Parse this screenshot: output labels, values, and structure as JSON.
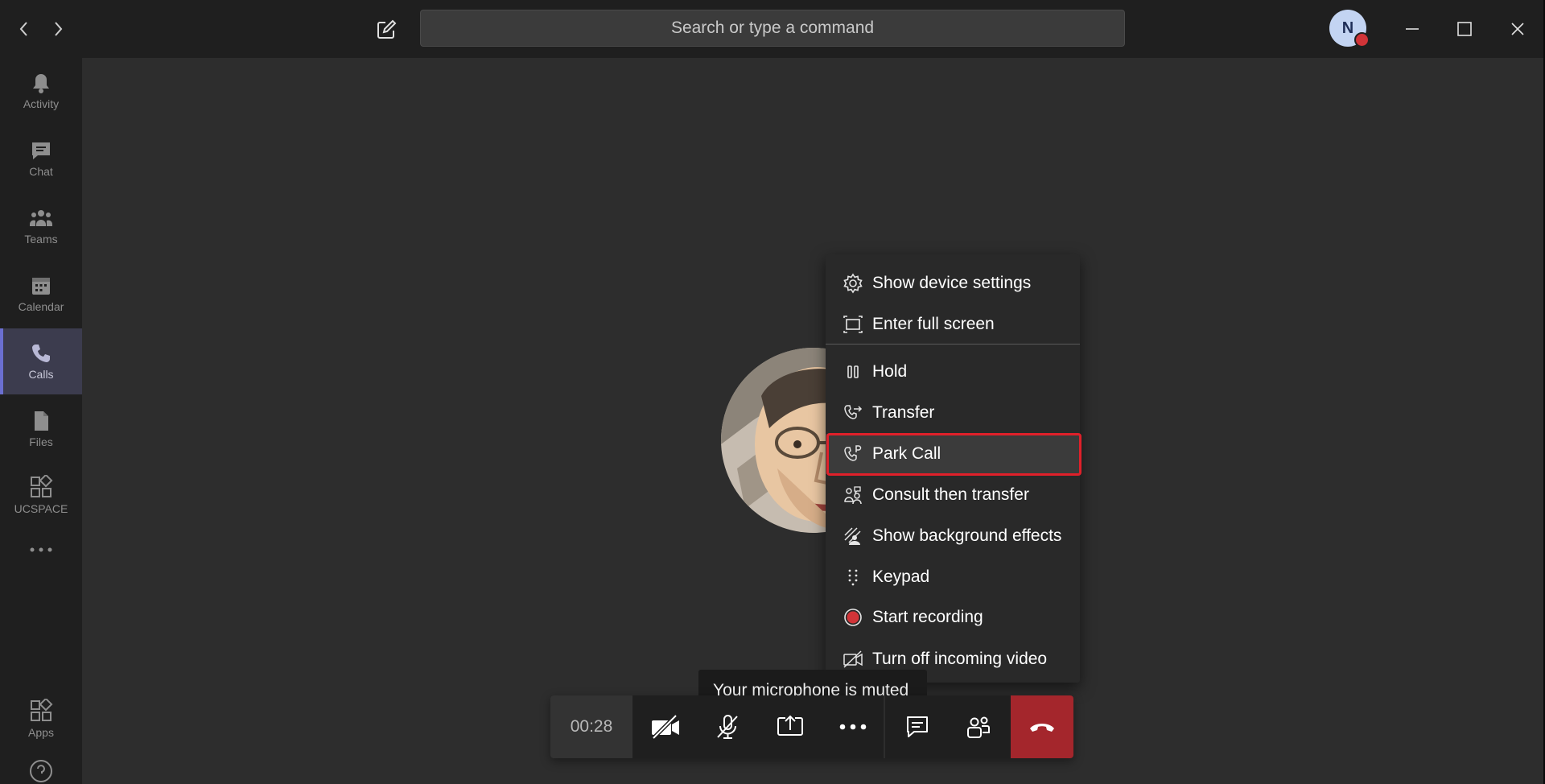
{
  "titlebar": {
    "back_icon": "chevron-left-icon",
    "forward_icon": "chevron-right-icon",
    "compose_icon": "compose-icon",
    "search_placeholder": "Search or type a command",
    "avatar_initial": "N",
    "presence_color": "#d13438"
  },
  "rail": {
    "items": [
      {
        "label": "Activity",
        "icon": "bell-icon"
      },
      {
        "label": "Chat",
        "icon": "chat-icon"
      },
      {
        "label": "Teams",
        "icon": "teams-icon"
      },
      {
        "label": "Calendar",
        "icon": "calendar-icon"
      },
      {
        "label": "Calls",
        "icon": "phone-icon",
        "active": true
      },
      {
        "label": "Files",
        "icon": "file-icon"
      },
      {
        "label": "UCSPACE",
        "icon": "app-grid-icon"
      },
      {
        "label": "",
        "icon": "more-icon"
      }
    ],
    "apps_label": "Apps",
    "help_icon": "help-icon"
  },
  "menu": {
    "items": [
      {
        "label": "Show device settings",
        "icon": "gear-icon"
      },
      {
        "label": "Enter full screen",
        "icon": "fullscreen-icon"
      },
      {
        "label": "Hold",
        "icon": "pause-icon"
      },
      {
        "label": "Transfer",
        "icon": "transfer-icon"
      },
      {
        "label": "Park Call",
        "icon": "park-call-icon",
        "highlighted": true
      },
      {
        "label": "Consult then transfer",
        "icon": "consult-icon"
      },
      {
        "label": "Show background effects",
        "icon": "background-effects-icon"
      },
      {
        "label": "Keypad",
        "icon": "keypad-icon"
      },
      {
        "label": "Start recording",
        "icon": "record-icon"
      },
      {
        "label": "Turn off incoming video",
        "icon": "video-off-icon"
      }
    ],
    "highlight_color": "#e0202a"
  },
  "toast": {
    "text": "Your microphone is muted"
  },
  "toolbar": {
    "timer": "00:28",
    "buttons": [
      "camera-off-icon",
      "mic-off-icon",
      "share-screen-icon",
      "more-actions-icon",
      "chat-icon",
      "participants-icon",
      "hang-up-icon"
    ],
    "hangup_color": "#a4262c"
  }
}
